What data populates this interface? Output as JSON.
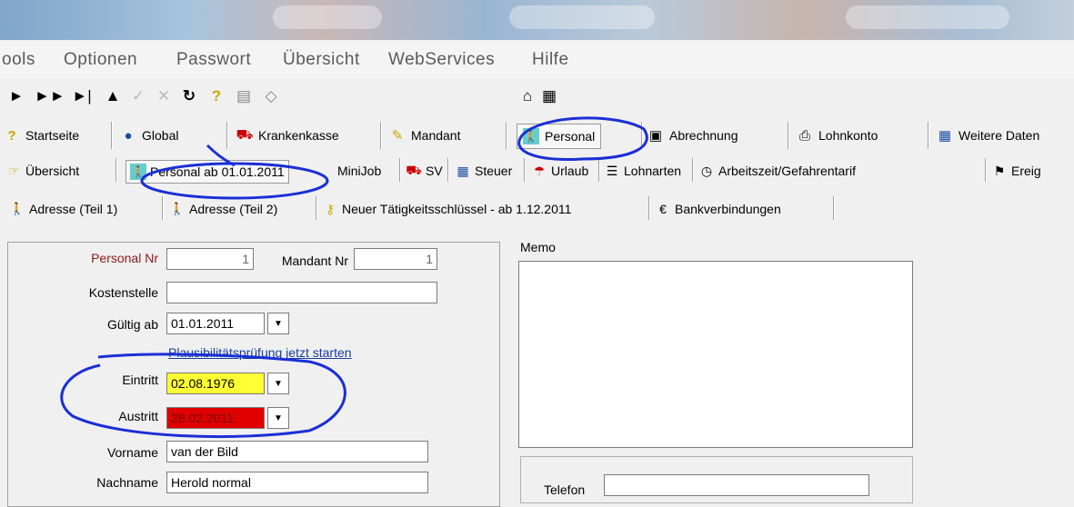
{
  "menu": [
    "ools",
    "Optionen",
    "Passwort",
    "Übersicht",
    "WebServices",
    "Hilfe"
  ],
  "toolbar_icons": [
    "play-icon",
    "fast-forward-icon",
    "skip-end-icon",
    "eject-icon",
    "check-icon",
    "cancel-icon",
    "refresh-icon",
    "help-icon",
    "document-icon",
    "eraser-icon",
    "folder-icon",
    "calendar-icon"
  ],
  "nav": {
    "startseite": "Startseite",
    "global": "Global",
    "krankenkasse": "Krankenkasse",
    "mandant": "Mandant",
    "personal": "Personal",
    "abrechnung": "Abrechnung",
    "lohnkonto": "Lohnkonto",
    "weitere": "Weitere Daten"
  },
  "subtabs": {
    "uebersicht": "Übersicht",
    "personal_ab": "Personal ab 01.01.2011",
    "minijob": "MiniJob",
    "sv": "SV",
    "steuer": "Steuer",
    "urlaub": "Urlaub",
    "lohnarten": "Lohnarten",
    "arbeitszeit": "Arbeitszeit/Gefahrentarif",
    "ereig": "Ereig"
  },
  "tabs3": {
    "adresse1": "Adresse (Teil 1)",
    "adresse2": "Adresse (Teil 2)",
    "taetigkeit": "Neuer Tätigkeitsschlüssel - ab 1.12.2011",
    "bank": "Bankverbindungen"
  },
  "form": {
    "personal_nr_label": "Personal Nr",
    "personal_nr": "1",
    "mandant_nr_label": "Mandant Nr",
    "mandant_nr": "1",
    "kostenstelle_label": "Kostenstelle",
    "kostenstelle": "",
    "gueltig_label": "Gültig ab",
    "gueltig": "01.01.2011",
    "plausi_link": "Plausibilitätsprüfung jetzt starten",
    "eintritt_label": "Eintritt",
    "eintritt": "02.08.1976",
    "austritt_label": "Austritt",
    "austritt": "28.02.2011",
    "vorname_label": "Vorname",
    "vorname": "van der Bild",
    "nachname_label": "Nachname",
    "nachname": "Herold normal",
    "memo_label": "Memo",
    "telefon_label": "Telefon",
    "telefon": ""
  },
  "colors": {
    "eintritt_bg": "#ffff33",
    "austritt_bg": "#e00000",
    "annotation": "#1a2fd6",
    "personal_nr_label": "#8b1a1a"
  }
}
